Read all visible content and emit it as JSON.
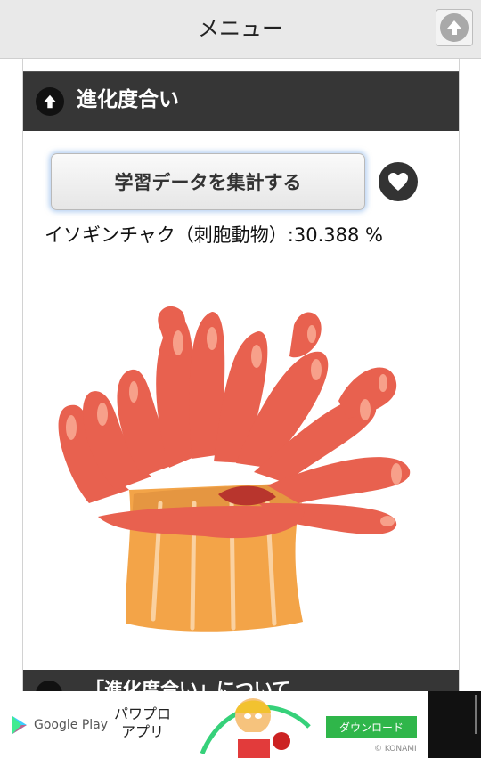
{
  "topbar": {
    "title": "メニュー"
  },
  "section": {
    "title": "進化度合い",
    "collect_button": "学習データを集計する",
    "result_text": "イソギンチャク（刺胞動物）:30.388 %"
  },
  "next_section": {
    "title": "「進化度合い」について"
  },
  "ad": {
    "store_label": "Google Play",
    "app_name_line1": "パワプロ",
    "app_name_line2": "アプリ",
    "download_label": "ダウンロード",
    "brand": "© KONAMI"
  }
}
